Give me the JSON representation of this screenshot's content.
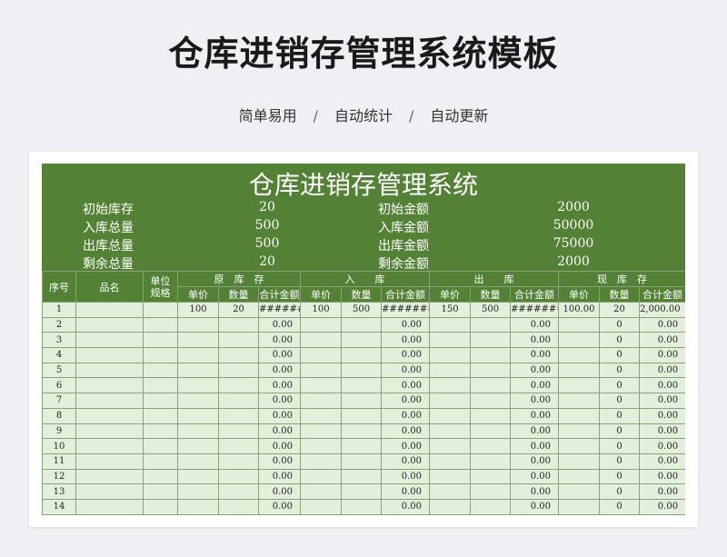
{
  "page": {
    "title": "仓库进销存管理系统模板",
    "tags": [
      "简单易用",
      "自动统计",
      "自动更新"
    ],
    "separator": "/"
  },
  "sheet": {
    "title": "仓库进销存管理系统",
    "summary": [
      {
        "label": "初始库存",
        "value": "20",
        "label2": "初始金额",
        "value2": "2000"
      },
      {
        "label": "入库总量",
        "value": "500",
        "label2": "入库金额",
        "value2": "50000"
      },
      {
        "label": "出库总量",
        "value": "500",
        "label2": "出库金额",
        "value2": "75000"
      },
      {
        "label": "剩余总量",
        "value": "20",
        "label2": "剩余金额",
        "value2": "2000"
      }
    ],
    "headers": {
      "seq": "序号",
      "name": "品名",
      "unit": "单位规格",
      "groups": [
        "原　库　存",
        "入　　库",
        "出　　库",
        "现　库　存"
      ],
      "sub": [
        "单价",
        "数量",
        "合计金额"
      ]
    },
    "rows": [
      [
        "1",
        "",
        "",
        "100",
        "20",
        "#######",
        "100",
        "500",
        "#########",
        "150",
        "500",
        "#########",
        "100.00",
        "20",
        "2,000.00"
      ],
      [
        "2",
        "",
        "",
        "",
        "",
        "0.00",
        "",
        "",
        "0.00",
        "",
        "",
        "0.00",
        "",
        "0",
        "0.00"
      ],
      [
        "3",
        "",
        "",
        "",
        "",
        "0.00",
        "",
        "",
        "0.00",
        "",
        "",
        "0.00",
        "",
        "0",
        "0.00"
      ],
      [
        "4",
        "",
        "",
        "",
        "",
        "0.00",
        "",
        "",
        "0.00",
        "",
        "",
        "0.00",
        "",
        "0",
        "0.00"
      ],
      [
        "5",
        "",
        "",
        "",
        "",
        "0.00",
        "",
        "",
        "0.00",
        "",
        "",
        "0.00",
        "",
        "0",
        "0.00"
      ],
      [
        "6",
        "",
        "",
        "",
        "",
        "0.00",
        "",
        "",
        "0.00",
        "",
        "",
        "0.00",
        "",
        "0",
        "0.00"
      ],
      [
        "7",
        "",
        "",
        "",
        "",
        "0.00",
        "",
        "",
        "0.00",
        "",
        "",
        "0.00",
        "",
        "0",
        "0.00"
      ],
      [
        "8",
        "",
        "",
        "",
        "",
        "0.00",
        "",
        "",
        "0.00",
        "",
        "",
        "0.00",
        "",
        "0",
        "0.00"
      ],
      [
        "9",
        "",
        "",
        "",
        "",
        "0.00",
        "",
        "",
        "0.00",
        "",
        "",
        "0.00",
        "",
        "0",
        "0.00"
      ],
      [
        "10",
        "",
        "",
        "",
        "",
        "0.00",
        "",
        "",
        "0.00",
        "",
        "",
        "0.00",
        "",
        "0",
        "0.00"
      ],
      [
        "11",
        "",
        "",
        "",
        "",
        "0.00",
        "",
        "",
        "0.00",
        "",
        "",
        "0.00",
        "",
        "0",
        "0.00"
      ],
      [
        "12",
        "",
        "",
        "",
        "",
        "0.00",
        "",
        "",
        "0.00",
        "",
        "",
        "0.00",
        "",
        "0",
        "0.00"
      ],
      [
        "13",
        "",
        "",
        "",
        "",
        "0.00",
        "",
        "",
        "0.00",
        "",
        "",
        "0.00",
        "",
        "0",
        "0.00"
      ],
      [
        "14",
        "",
        "",
        "",
        "",
        "0.00",
        "",
        "",
        "0.00",
        "",
        "",
        "0.00",
        "",
        "0",
        "0.00"
      ]
    ]
  }
}
